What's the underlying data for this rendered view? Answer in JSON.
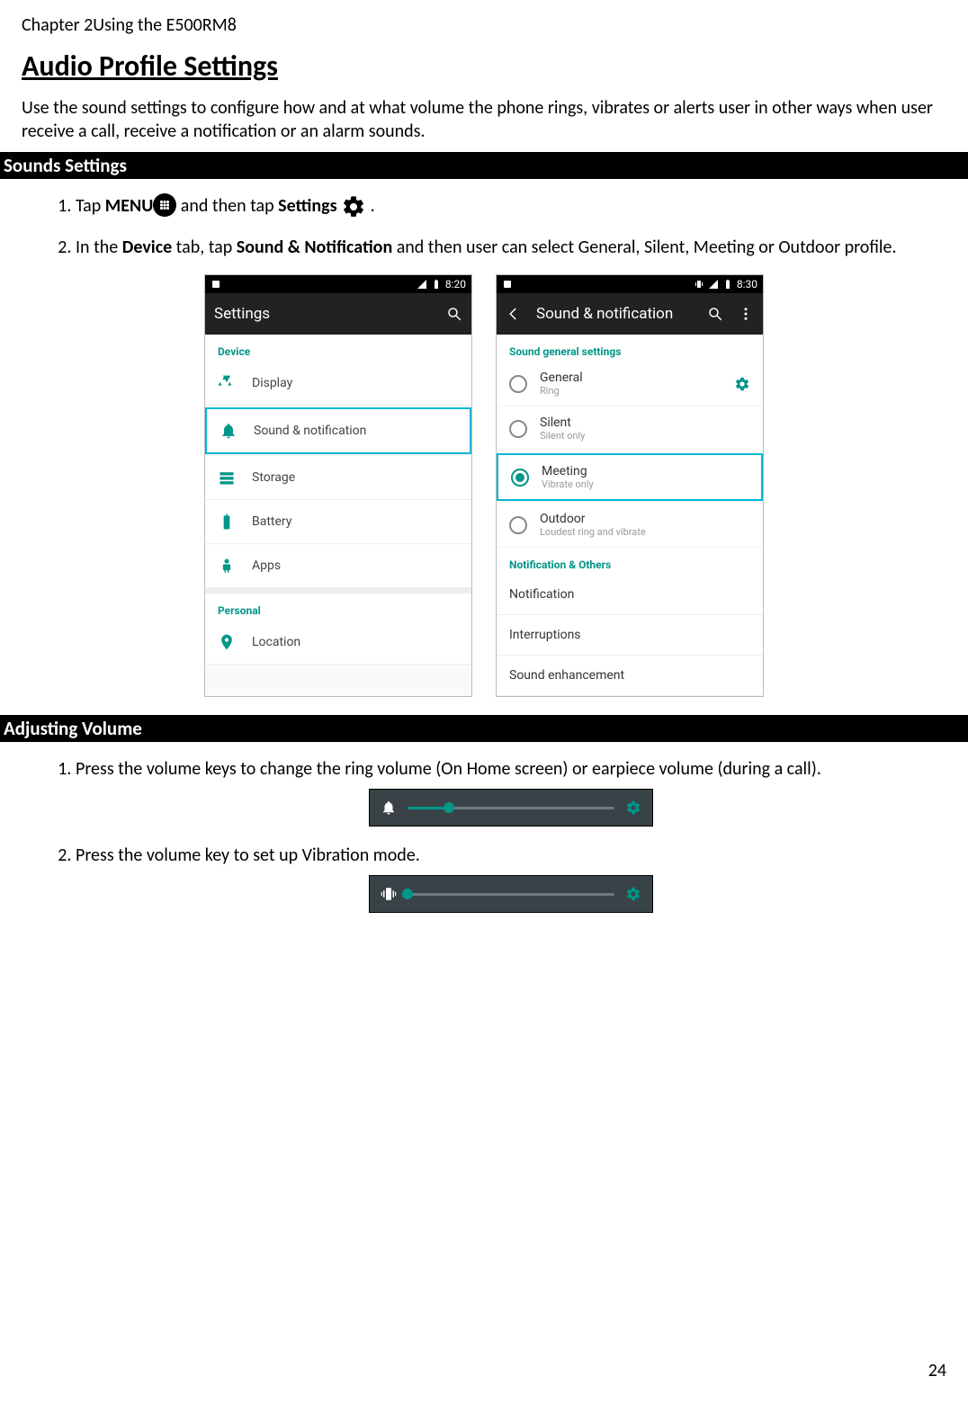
{
  "chapter_header": "Chapter 2Using the E500RM8",
  "title": "Audio Profile Settings",
  "intro": "Use the sound settings to configure how and at what volume the phone rings, vibrates or alerts user in other ways when user receive a call, receive a notification or an alarm sounds.",
  "sections": {
    "sounds": "Sounds Settings",
    "adjusting": "Adjusting Volume"
  },
  "sounds_steps": {
    "s1_pre": "Tap ",
    "s1_menu": "MENU",
    "s1_mid": " and then tap ",
    "s1_settings": "Settings",
    "s1_post": " .",
    "s2_pre": "In the ",
    "s2_device": "Device",
    "s2_mid1": " tab, tap ",
    "s2_sound": "Sound & Notification",
    "s2_mid2": " and then user can select General, Silent, Meeting or Outdoor profile."
  },
  "adjusting_steps": {
    "a1": "Press the volume keys to change the ring volume (On Home screen) or earpiece volume (during a call).",
    "a2": "Press the volume key to set up Vibration mode."
  },
  "shot_left": {
    "time": "8:20",
    "appbar_title": "Settings",
    "device_header": "Device",
    "items": [
      "Display",
      "Sound & notification",
      "Storage",
      "Battery",
      "Apps"
    ],
    "personal_header": "Personal",
    "personal_item": "Location"
  },
  "shot_right": {
    "time": "8:30",
    "appbar_title": "Sound & notification",
    "general_header": "Sound general settings",
    "profiles": [
      {
        "title": "General",
        "sub": "Ring"
      },
      {
        "title": "Silent",
        "sub": "Silent only"
      },
      {
        "title": "Meeting",
        "sub": "Vibrate only"
      },
      {
        "title": "Outdoor",
        "sub": "Loudest ring and vibrate"
      }
    ],
    "others_header": "Notification & Others",
    "others": [
      "Notification",
      "Interruptions",
      "Sound enhancement"
    ]
  },
  "volume_shots": {
    "ring_level_pct": 20,
    "vibration_level_pct": 0
  },
  "page_number": "24"
}
